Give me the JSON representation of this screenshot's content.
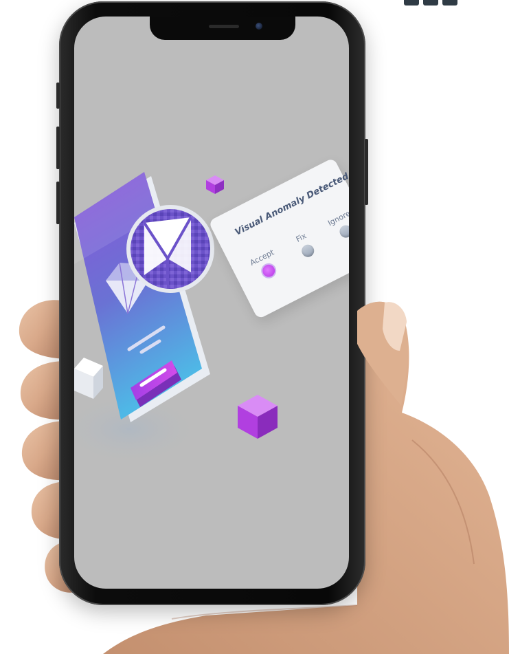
{
  "scene": {
    "alt": "Hand holding a smartphone showing a visual testing illustration"
  },
  "dialog": {
    "title": "Visual Anomaly Detected",
    "options": [
      {
        "label": "Accept",
        "selected": true
      },
      {
        "label": "Fix",
        "selected": false
      },
      {
        "label": "Ignore",
        "selected": false
      }
    ]
  },
  "colors": {
    "screen_bg": "#bcbcbc",
    "accent_purple": "#b13fe0",
    "gradient_top": "#7b4fd6",
    "gradient_bottom": "#53b3e3",
    "dialog_text": "#4a5a78"
  }
}
